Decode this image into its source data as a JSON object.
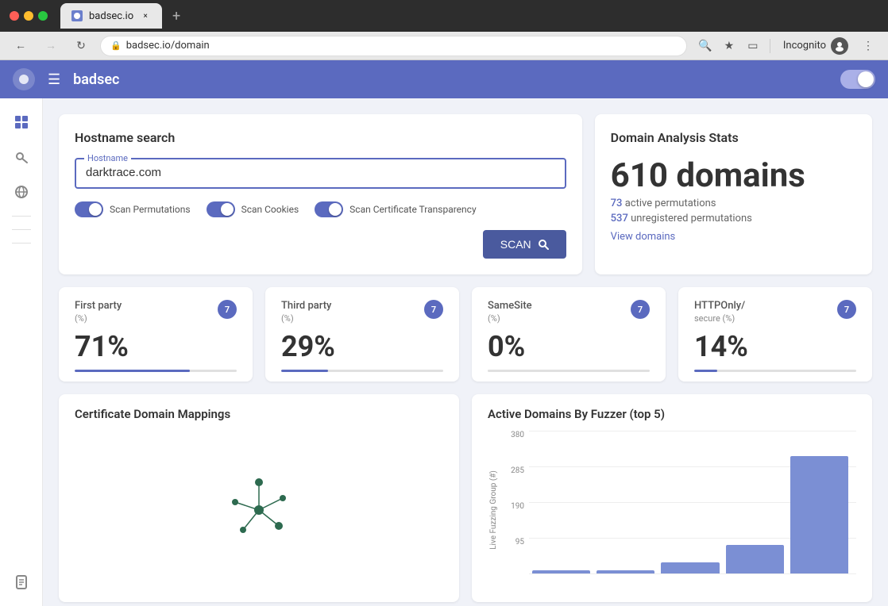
{
  "browser": {
    "tab_title": "badsec.io",
    "url": "badsec.io/domain",
    "new_tab_label": "+",
    "close_label": "×",
    "back_disabled": false,
    "forward_disabled": true,
    "incognito_label": "Incognito"
  },
  "app": {
    "title": "badsec",
    "toggle_on": true
  },
  "hostname_card": {
    "title": "Hostname search",
    "input_label": "Hostname",
    "input_value": "darktrace.com",
    "toggle1_label": "Scan Permutations",
    "toggle2_label": "Scan Cookies",
    "toggle3_label": "Scan Certificate Transparency",
    "scan_button": "SCAN"
  },
  "stats_card": {
    "title": "Domain Analysis Stats",
    "big_number": "610 domains",
    "active_count": "73",
    "active_label": "active permutations",
    "unregistered_count": "537",
    "unregistered_label": "unregistered permutations",
    "view_link": "View domains"
  },
  "metrics": [
    {
      "title": "First party",
      "subtitle": "(%)",
      "value": "71%",
      "badge": "7",
      "bar_pct": 71
    },
    {
      "title": "Third party",
      "subtitle": "(%)",
      "value": "29%",
      "badge": "7",
      "bar_pct": 29
    },
    {
      "title": "SameSite",
      "subtitle": "(%)",
      "value": "0%",
      "badge": "7",
      "bar_pct": 0
    },
    {
      "title": "HTTPOnly/",
      "subtitle2": "secure (%)",
      "subtitle": "(%)",
      "value": "14%",
      "badge": "7",
      "bar_pct": 14
    }
  ],
  "cert_card": {
    "title": "Certificate Domain Mappings"
  },
  "fuzzer_card": {
    "title": "Active Domains By Fuzzer (top 5)",
    "y_labels": [
      "380",
      "285",
      "190",
      "95",
      ""
    ],
    "y_axis_title": "Live Fuzzing Group (#)",
    "bars": [
      {
        "height_pct": 2,
        "label": ""
      },
      {
        "height_pct": 2,
        "label": ""
      },
      {
        "height_pct": 8,
        "label": ""
      },
      {
        "height_pct": 20,
        "label": ""
      },
      {
        "height_pct": 82,
        "label": ""
      }
    ]
  }
}
